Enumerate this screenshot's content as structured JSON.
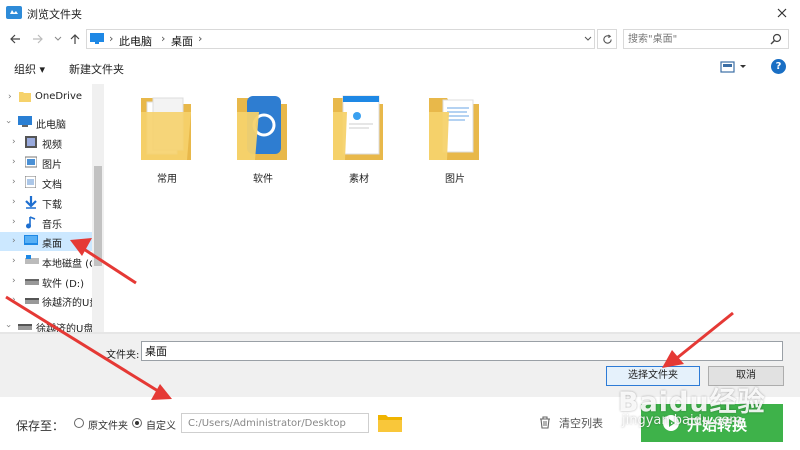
{
  "dialog": {
    "title": "浏览文件夹",
    "breadcrumb": [
      "此电脑",
      "桌面"
    ],
    "search_placeholder": "搜索\"桌面\"",
    "toolbar": {
      "organize_label": "组织 ▾",
      "new_folder_label": "新建文件夹"
    },
    "help_label": "?",
    "nav_items": [
      {
        "label": "OneDrive",
        "icon": "folder-icon"
      },
      {
        "label": "此电脑",
        "icon": "computer-icon"
      },
      {
        "label": "视频",
        "icon": "video-icon"
      },
      {
        "label": "图片",
        "icon": "picture-icon"
      },
      {
        "label": "文档",
        "icon": "document-icon"
      },
      {
        "label": "下载",
        "icon": "download-icon"
      },
      {
        "label": "音乐",
        "icon": "music-icon"
      },
      {
        "label": "桌面",
        "icon": "desktop-icon",
        "selected": true
      },
      {
        "label": "本地磁盘 (C:)",
        "icon": "drive-icon"
      },
      {
        "label": "软件 (D:)",
        "icon": "drive-icon"
      },
      {
        "label": "徐越济的U盘",
        "icon": "usb-drive-icon"
      },
      {
        "label": "徐越济的U盘",
        "icon": "usb-drive-icon"
      }
    ],
    "files": [
      {
        "name": "常用",
        "icon": "folder-documents-icon"
      },
      {
        "name": "软件",
        "icon": "folder-app-icon"
      },
      {
        "name": "素材",
        "icon": "folder-installer-icon"
      },
      {
        "name": "图片",
        "icon": "folder-pictures-icon"
      }
    ],
    "folder_label": "文件夹:",
    "folder_value": "桌面",
    "select_button": "选择文件夹",
    "cancel_button": "取消"
  },
  "app": {
    "save_to_label": "保存至：",
    "option_source": "原文件夹",
    "option_custom": "自定义",
    "path_value": "C:/Users/Administrator/Desktop",
    "clear_list_label": "清空列表",
    "start_label": "开始转换"
  },
  "watermark": {
    "line1": "Baidu经验",
    "line2": "jingyan.baidu.com"
  },
  "colors": {
    "accent_green": "#3eb24a",
    "selection_blue": "#cce8ff",
    "arrow_red": "#e53935"
  }
}
